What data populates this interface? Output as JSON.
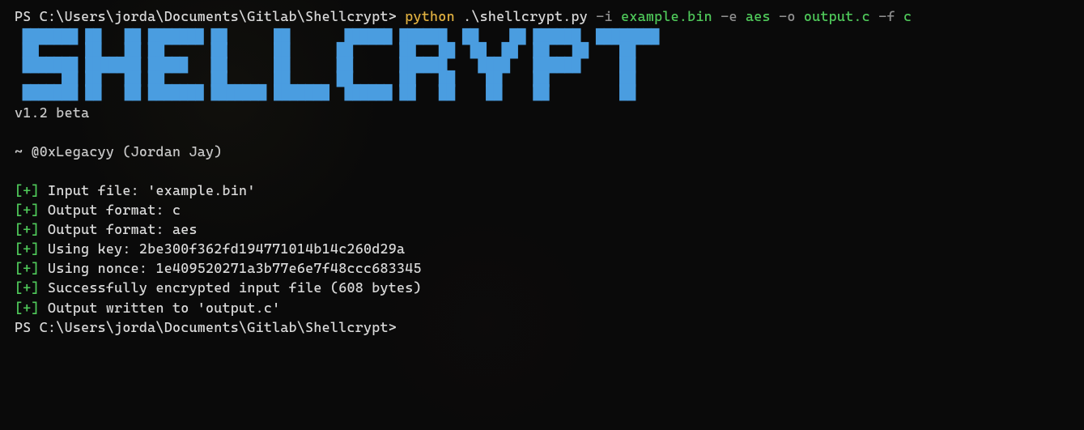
{
  "command_line": {
    "prompt": "PS C:\\Users\\jorda\\Documents\\Gitlab\\Shellcrypt> ",
    "cmd": "python",
    "script": " .\\shellcrypt.py ",
    "flag_i": "-i",
    "arg_i": " example.bin ",
    "flag_e": "-e",
    "arg_e": " aes ",
    "flag_o": "-o",
    "arg_o": " output.c ",
    "flag_f": "-f",
    "arg_f": " c"
  },
  "banner": {
    "ascii": " ███████ ██   ██ ███████ ██      ██       ██████ ██████  ██    ██ ██████  ████████\n ██      ██   ██ ██      ██      ██      ██      ██   ██  ██  ██  ██   ██    ██\n ███████ ███████ █████   ██      ██      ██      ██████    ████   ██████     ██\n      ██ ██   ██ ██      ██      ██      ██      ██   ██    ██    ██         ██\n ███████ ██   ██ ███████ ███████ ███████  ██████ ██   ██    ██    ██         ██",
    "version": "v1.2 beta",
    "author": "~ @0xLegacyy (Jordan Jay)"
  },
  "output": {
    "prefix_open": "[",
    "prefix_plus": "+",
    "prefix_close": "]",
    "lines": [
      " Input file: 'example.bin'",
      " Output format: c",
      " Output format: aes",
      " Using key: 2be300f362fd194771014b14c260d29a",
      " Using nonce: 1e409520271a3b77e6e7f48ccc683345",
      " Successfully encrypted input file (608 bytes)",
      " Output written to 'output.c'"
    ]
  },
  "final_prompt": "PS C:\\Users\\jorda\\Documents\\Gitlab\\Shellcrypt>"
}
